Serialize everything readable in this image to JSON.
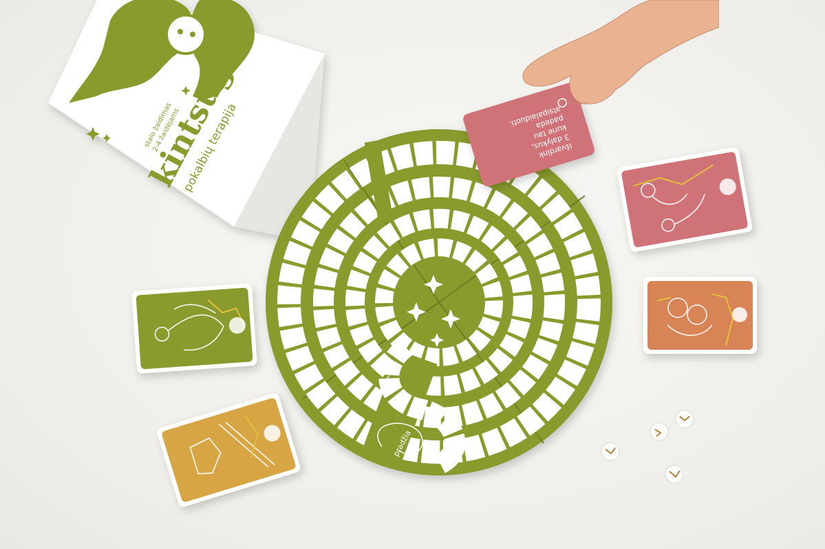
{
  "box": {
    "title": "kintsugi",
    "subtitle": "pokalbių terapija",
    "tagline_line1": "stalo žaidimas",
    "tagline_line2": "2-4 žaidėjams"
  },
  "board": {
    "start_label": "pradžia"
  },
  "held_card": {
    "line1": "Išvardink",
    "line2": "3 dalykus,",
    "line3": "kurie tau",
    "line4": "padeda",
    "line5": "atsipalaiduoti."
  },
  "colors": {
    "olive": "#8a9a2c",
    "pink": "#cf7379",
    "orange": "#d98457",
    "mustard": "#d7a544",
    "gold": "#e2c23a",
    "white": "#ffffff"
  },
  "icons": [
    "heart-icon",
    "eye-icon",
    "pencil-icon",
    "star-icon",
    "dice-icon"
  ]
}
